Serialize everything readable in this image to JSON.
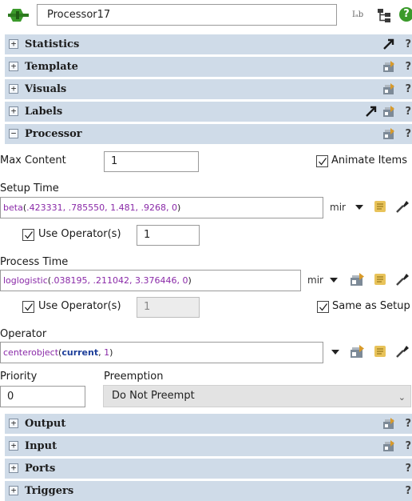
{
  "header": {
    "object_name": "Processor17",
    "object_icon": "processor-object-icon",
    "label_icon_text": "Iₐb",
    "tree_icon": "tree-icon",
    "help_icon_text": "?"
  },
  "sections_top": [
    {
      "label": "Statistics",
      "expander": "+",
      "icons": [
        "pointer-arrow-icon"
      ],
      "help": "?"
    },
    {
      "label": "Template",
      "expander": "+",
      "icons": [
        "template-icon"
      ],
      "help": "?"
    },
    {
      "label": "Visuals",
      "expander": "+",
      "icons": [
        "template-icon"
      ],
      "help": "?"
    },
    {
      "label": "Labels",
      "expander": "+",
      "icons": [
        "pointer-arrow-icon",
        "template-icon"
      ],
      "help": "?"
    },
    {
      "label": "Processor",
      "expander": "−",
      "icons": [
        "template-icon"
      ],
      "help": "?"
    }
  ],
  "processor": {
    "max_content_label": "Max Content",
    "max_content_value": "1",
    "animate_items_label": "Animate Items",
    "animate_items_checked": true,
    "setup_time_label": "Setup Time",
    "setup_time": {
      "fn": "beta",
      "args": ".423331, .785550, 1.481, .9268, 0"
    },
    "setup_unit": "mir",
    "use_operators_label": "Use Operator(s)",
    "setup_use_operators_checked": true,
    "setup_operators_count": "1",
    "process_time_label": "Process Time",
    "process_time": {
      "fn": "loglogistic",
      "args": ".038195, .211042, 3.376446, 0"
    },
    "process_unit": "mir",
    "process_use_operators_checked": true,
    "process_operators_count": "1",
    "same_as_setup_label": "Same as Setup",
    "same_as_setup_checked": true,
    "operator_label": "Operator",
    "operator": {
      "fn": "centerobject",
      "arg1": "current",
      "arg2": "1"
    },
    "priority_label": "Priority",
    "priority_value": "0",
    "preemption_label": "Preemption",
    "preemption_value": "Do Not Preempt"
  },
  "sections_bottom": [
    {
      "label": "Output",
      "expander": "+",
      "icons": [
        "template-icon"
      ],
      "help": "?"
    },
    {
      "label": "Input",
      "expander": "+",
      "icons": [
        "template-icon"
      ],
      "help": "?"
    },
    {
      "label": "Ports",
      "expander": "+",
      "icons": [],
      "help": "?"
    },
    {
      "label": "Triggers",
      "expander": "+",
      "icons": [],
      "help": "?"
    }
  ],
  "colors": {
    "section_bar": "#cfdbe8",
    "function_text": "#8a2aa8",
    "keyword_text": "#1e3f9a",
    "help_green": "#3a9a2a"
  }
}
